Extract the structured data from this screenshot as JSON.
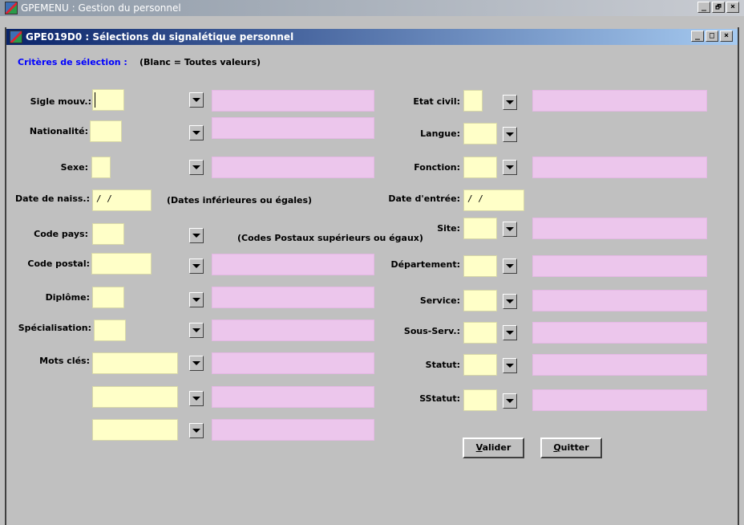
{
  "app": {
    "title": "GPEMENU : Gestion du personnel"
  },
  "window": {
    "title": "GPE019D0 : Sélections du signalétique personnel"
  },
  "window_buttons": {
    "min": "_",
    "max": "□",
    "close": "×",
    "restore": "🗗"
  },
  "criteria": {
    "heading": "Critères de sélection :",
    "hint": "(Blanc = Toutes valeurs)"
  },
  "notes": {
    "dates": "(Dates inférieures ou égales)",
    "postal": "(Codes Postaux supérieurs ou égaux)"
  },
  "left_fields": {
    "sigle_mouv": {
      "label": "Sigle mouv.:",
      "value": ""
    },
    "nationalite": {
      "label": "Nationalité:",
      "value": ""
    },
    "sexe": {
      "label": "Sexe:",
      "value": ""
    },
    "date_naiss": {
      "label": "Date de naiss.:",
      "value": " / /"
    },
    "code_pays": {
      "label": "Code pays:",
      "value": ""
    },
    "code_postal": {
      "label": "Code postal:",
      "value": ""
    },
    "diplome": {
      "label": "Diplôme:",
      "value": ""
    },
    "specialisation": {
      "label": "Spécialisation:",
      "value": ""
    },
    "mots_cles": {
      "label": "Mots clés:",
      "values": [
        "",
        "",
        ""
      ]
    }
  },
  "right_fields": {
    "etat_civil": {
      "label": "Etat civil:",
      "value": ""
    },
    "langue": {
      "label": "Langue:",
      "value": ""
    },
    "fonction": {
      "label": "Fonction:",
      "value": ""
    },
    "date_entree": {
      "label": "Date d'entrée:",
      "value": " / /"
    },
    "site": {
      "label": "Site:",
      "value": ""
    },
    "departement": {
      "label": "Département:",
      "value": ""
    },
    "service": {
      "label": "Service:",
      "value": ""
    },
    "sous_serv": {
      "label": "Sous-Serv.:",
      "value": ""
    },
    "statut": {
      "label": "Statut:",
      "value": ""
    },
    "sstatut": {
      "label": "SStatut:",
      "value": ""
    }
  },
  "buttons": {
    "valider": {
      "accel": "V",
      "rest": "alider"
    },
    "quitter": {
      "accel": "Q",
      "rest": "uitter"
    }
  },
  "colors": {
    "input_bg": "#ffffc8",
    "description_bg": "#ecc6ec",
    "window_bg": "#c0c0c0",
    "active_title": "#0a246a",
    "criteria_text": "#0000ff"
  }
}
